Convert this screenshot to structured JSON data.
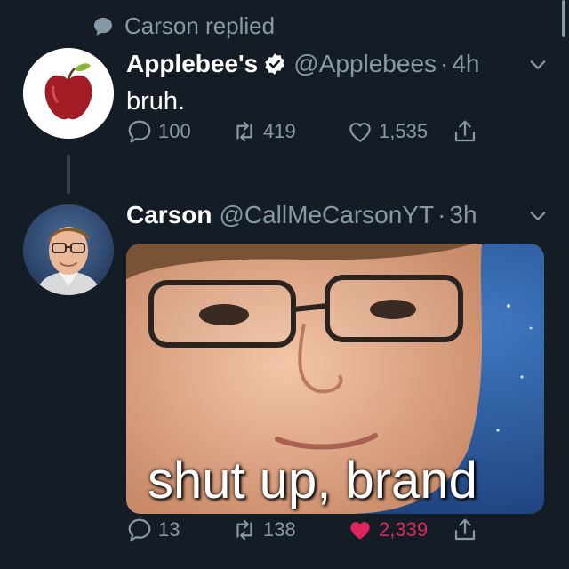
{
  "reply_context": {
    "text": "Carson replied",
    "icon": "speech-bubble-icon"
  },
  "tweets": [
    {
      "name": "Applebee's",
      "verified": true,
      "handle": "@Applebees",
      "separator": "·",
      "time": "4h",
      "text": "bruh.",
      "avatar": "applebees-apple-logo",
      "actions": {
        "replies": "100",
        "retweets": "419",
        "likes": "1,535"
      }
    },
    {
      "name": "Carson",
      "verified": false,
      "handle": "@CallMeCarsonYT",
      "separator": "·",
      "time": "3h",
      "avatar": "person-photo",
      "media": {
        "caption": "shut up, brand"
      },
      "actions": {
        "replies": "13",
        "retweets": "138",
        "likes": "2,339",
        "liked": true
      }
    }
  ],
  "colors": {
    "background": "#141d26",
    "muted": "#8899a6",
    "like_active": "#e0245e",
    "verified": "#ffffff"
  }
}
